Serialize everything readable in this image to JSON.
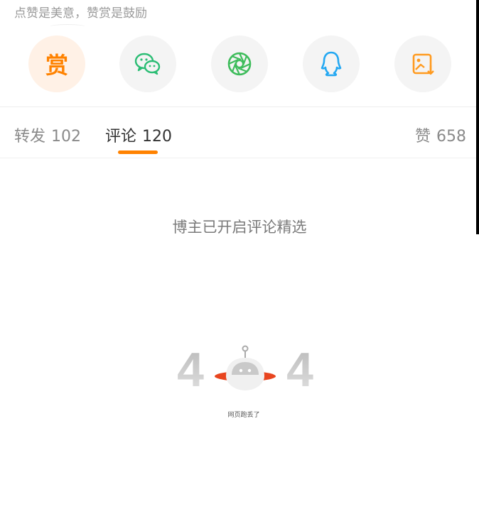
{
  "tip_text": "点赞是美意，赞赏是鼓励",
  "share": {
    "reward_label": "赏",
    "items": [
      {
        "icon": "reward-icon",
        "color": "#ff8200"
      },
      {
        "icon": "wechat-icon",
        "color": "#2bbd74"
      },
      {
        "icon": "moments-icon",
        "color": "#3ebc5b"
      },
      {
        "icon": "qq-icon",
        "color": "#24a8f2"
      },
      {
        "icon": "save-image-icon",
        "color": "#ff9a1f"
      }
    ]
  },
  "tabs": {
    "repost_label": "转发",
    "repost_count": "102",
    "comment_label": "评论",
    "comment_count": "120",
    "like_label": "赞",
    "like_count": "658"
  },
  "accent_color": "#ff8200",
  "featured_text": "博主已开启评论精选",
  "error": {
    "code_left": "4",
    "code_right": "4",
    "message": "网页跑丢了"
  }
}
